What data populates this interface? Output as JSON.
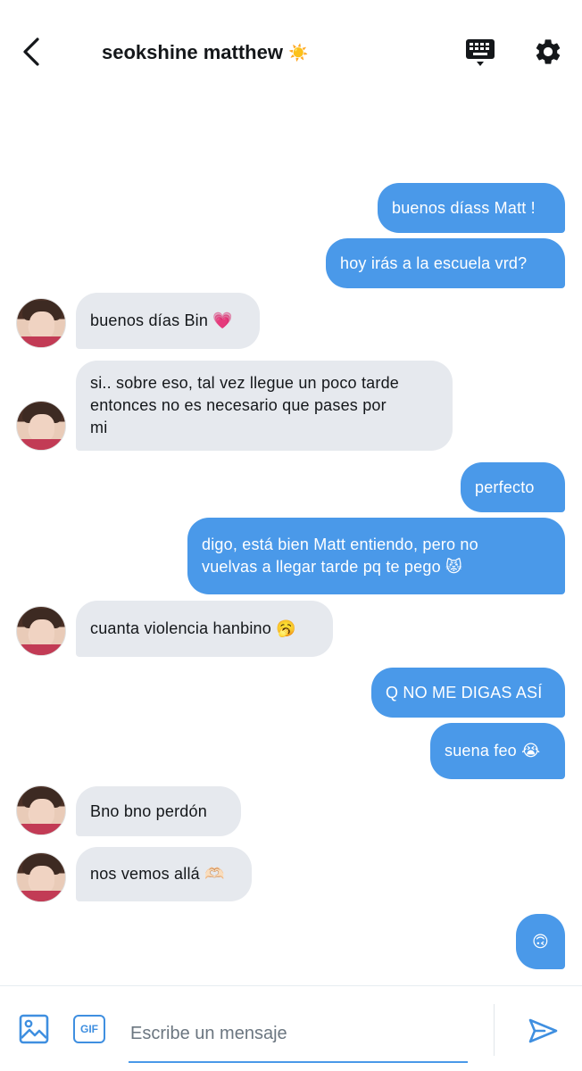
{
  "header": {
    "title": "seokshine matthew",
    "title_emoji": "☀️"
  },
  "messages": [
    {
      "from": "me",
      "text": "buenos díass Matt !"
    },
    {
      "from": "me",
      "text": "hoy irás a la escuela vrd?"
    },
    {
      "from": "them",
      "text": "buenos días Bin 💗"
    },
    {
      "from": "them",
      "text": "si.. sobre eso, tal vez llegue un poco tarde\nentonces no es necesario que pases por\nmi"
    },
    {
      "from": "me",
      "text": "perfecto"
    },
    {
      "from": "me",
      "text": "digo, está bien Matt entiendo, pero no\nvuelvas a llegar tarde pq te pego 😾"
    },
    {
      "from": "them",
      "text": "cuanta violencia hanbino 🥱"
    },
    {
      "from": "me",
      "text": "Q NO ME DIGAS ASÍ"
    },
    {
      "from": "me",
      "text": "suena feo 😭"
    },
    {
      "from": "them",
      "text": "Bno bno perdón"
    },
    {
      "from": "them",
      "text": "nos vemos allá 🫶🏻"
    },
    {
      "from": "me",
      "text": "🙃"
    }
  ],
  "composer": {
    "placeholder": "Escribe un mensaje",
    "gif_label": "GIF"
  },
  "colors": {
    "accent": "#4a99e9",
    "incoming_bubble": "#e6e9ee",
    "outgoing_text": "#ffffff"
  },
  "icons": {
    "back": "chevron-left-icon",
    "keyboard": "keyboard-icon",
    "settings": "gear-icon",
    "image": "image-icon",
    "gif": "gif-icon",
    "send": "send-icon"
  }
}
